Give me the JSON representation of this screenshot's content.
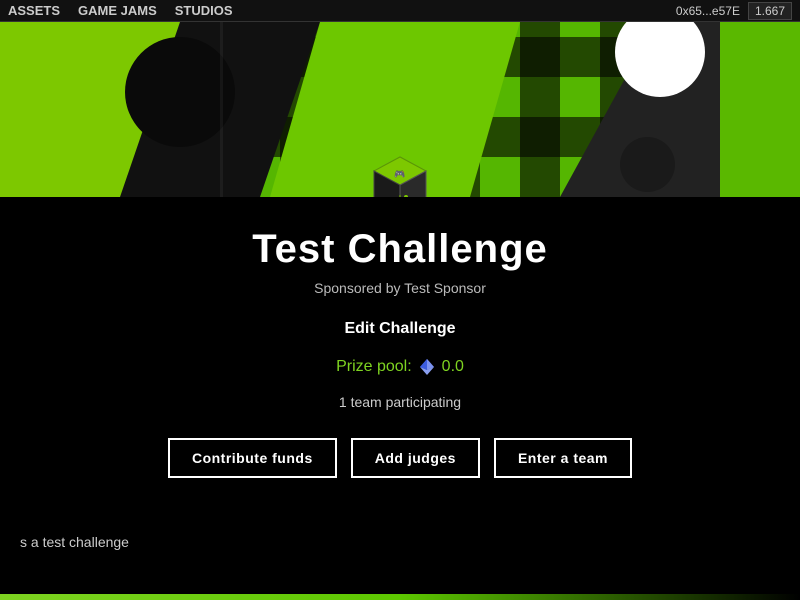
{
  "nav": {
    "items": [
      {
        "label": "Assets",
        "id": "assets"
      },
      {
        "label": "Game Jams",
        "id": "game-jams"
      },
      {
        "label": "Studios",
        "id": "studios"
      }
    ],
    "wallet_address": "0x65...e57E",
    "wallet_balance": "1.667"
  },
  "hero": {
    "logo_alt": "Game cube logo"
  },
  "main": {
    "title": "Test Challenge",
    "sponsored_by": "Sponsored by Test Sponsor",
    "edit_label": "Edit Challenge",
    "prize_pool_label": "Prize pool:",
    "prize_pool_value": "0.0",
    "teams_info": "1 team participating",
    "description": "s a test challenge"
  },
  "buttons": {
    "contribute": "Contribute funds",
    "add_judges": "Add judges",
    "enter_team": "Enter a team"
  }
}
